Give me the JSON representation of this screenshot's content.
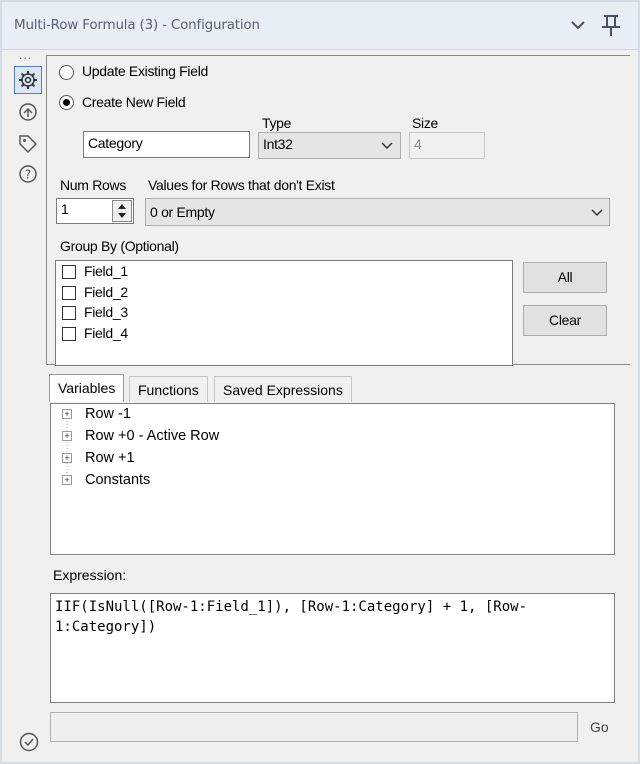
{
  "window": {
    "title": "Multi-Row Formula (3) - Configuration"
  },
  "rail": {
    "dots": "..."
  },
  "config": {
    "update_existing_label": "Update Existing Field",
    "create_new_label": "Create New  Field",
    "new_field_value": "Category",
    "type_label": "Type",
    "type_value": "Int32",
    "size_label": "Size",
    "size_value": "4",
    "num_rows_label": "Num Rows",
    "num_rows_value": "1",
    "values_label": "Values for Rows that don't Exist",
    "values_value": "0 or Empty",
    "group_by_label": "Group By (Optional)",
    "group_fields": [
      "Field_1",
      "Field_2",
      "Field_3",
      "Field_4"
    ],
    "all_button": "All",
    "clear_button": "Clear"
  },
  "tabs": [
    "Variables",
    "Functions",
    "Saved Expressions"
  ],
  "variables": [
    "Row -1",
    "Row +0 - Active Row",
    "Row +1",
    "Constants"
  ],
  "expression": {
    "label": "Expression:",
    "text": "IIF(IsNull([Row-1:Field_1]), [Row-1:Category] + 1, [Row-1:Category])"
  },
  "go_button": "Go",
  "colors": {
    "title_bar": "#e9edf4",
    "accent": "#5b7fb0",
    "panel": "#f0f0f0"
  }
}
